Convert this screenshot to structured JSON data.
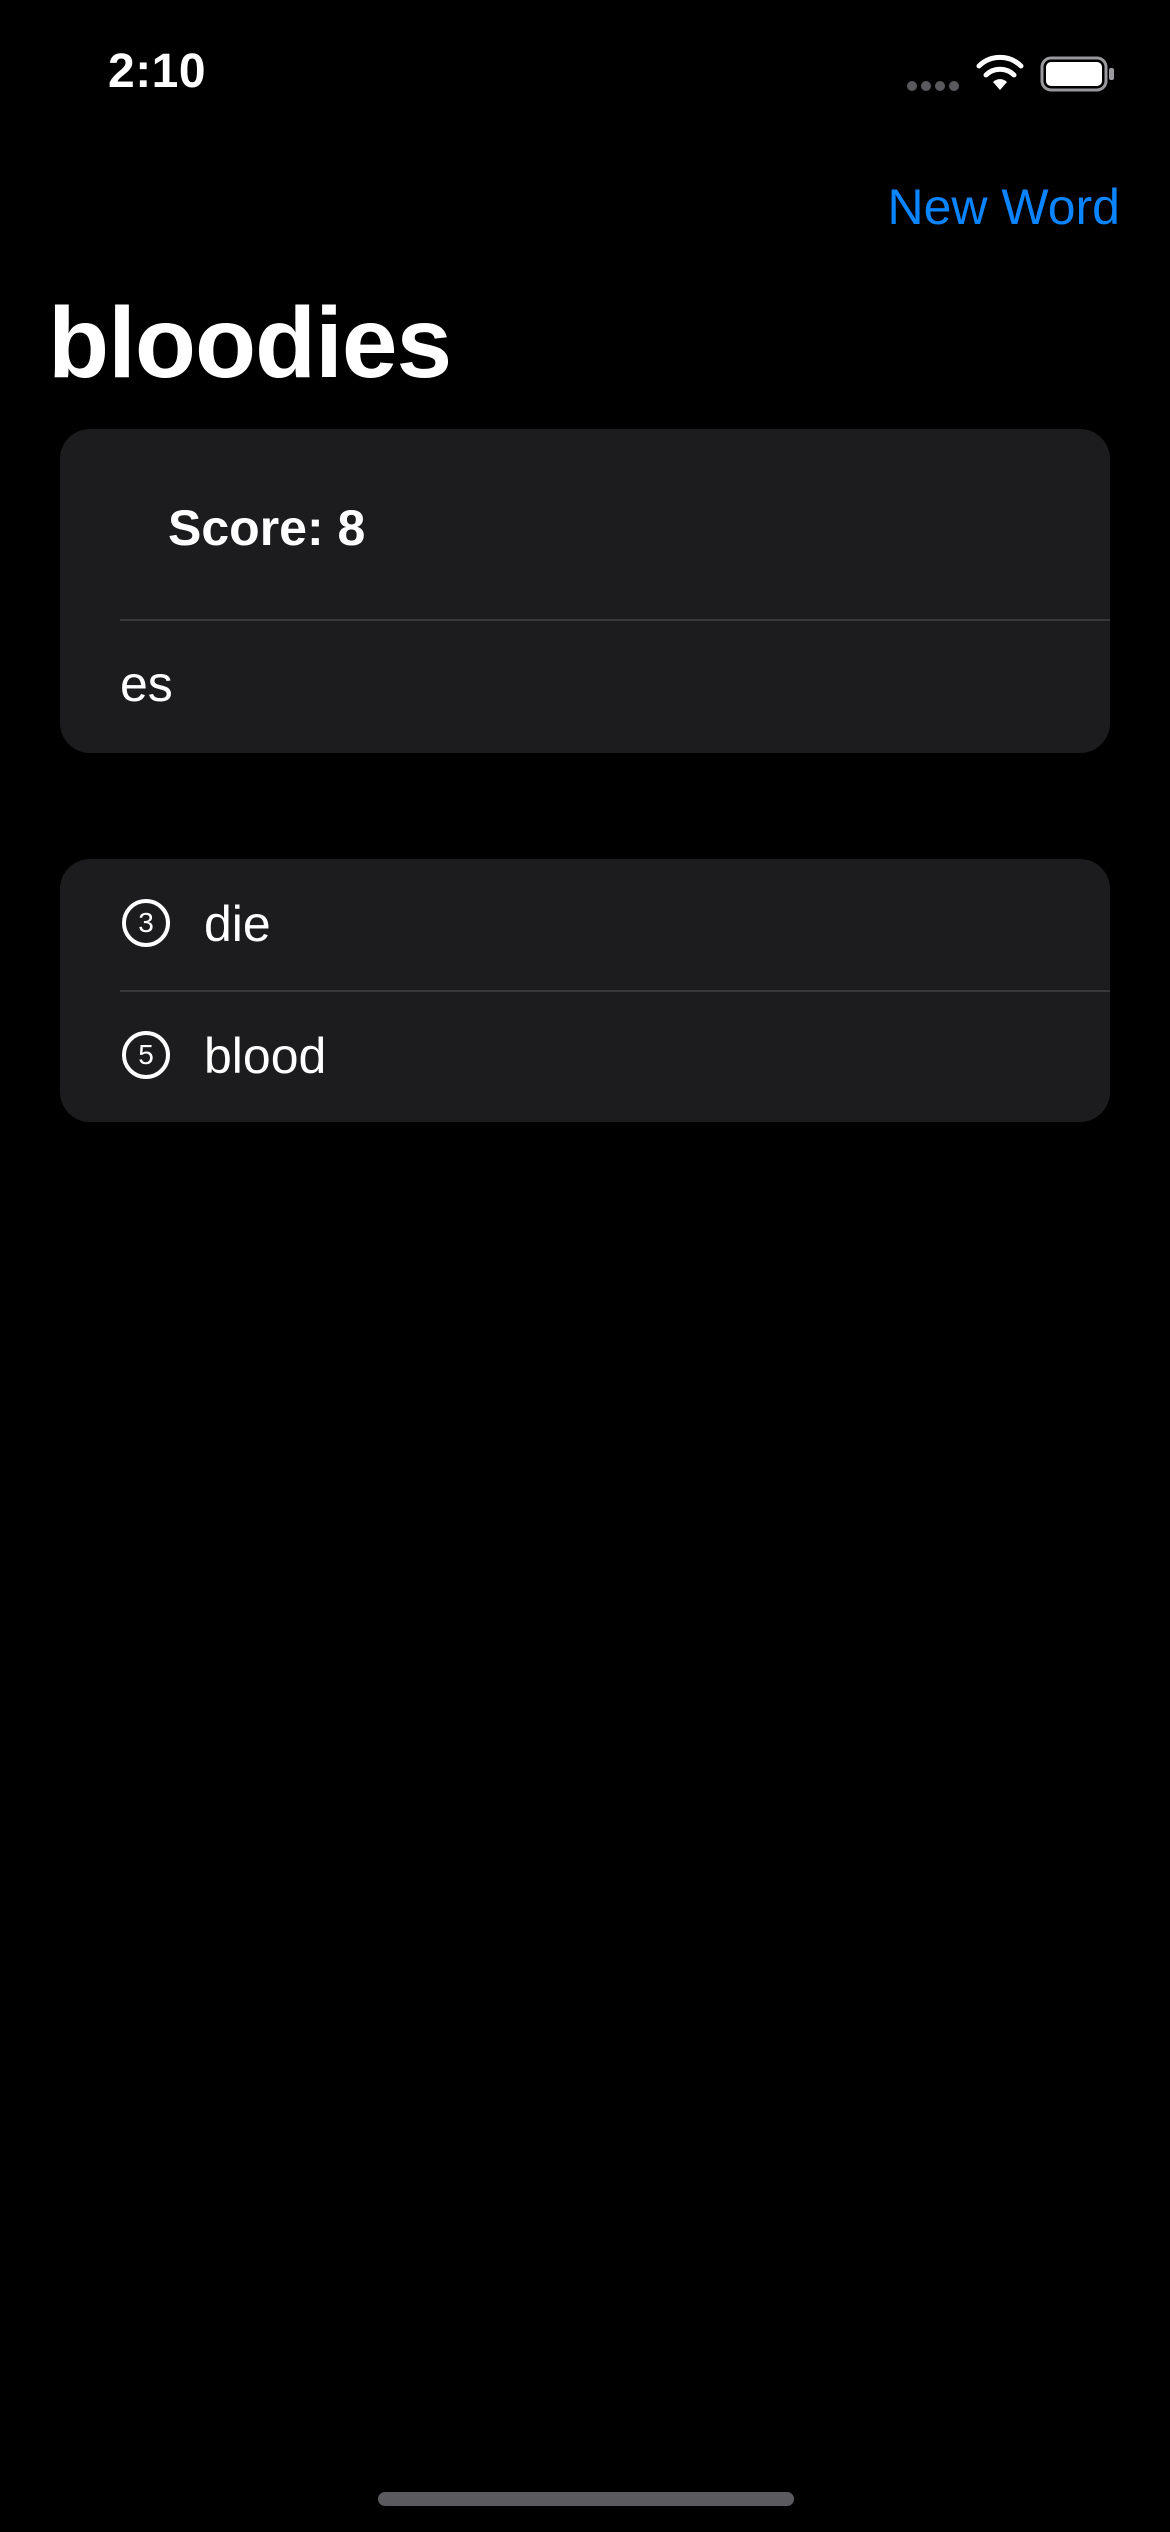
{
  "status_bar": {
    "time": "2:10",
    "signal_icon": "cellular-signal-icon",
    "wifi_icon": "wifi-icon",
    "battery_icon": "battery-icon"
  },
  "nav": {
    "new_word_label": "New Word"
  },
  "root_word": "bloodies",
  "score": {
    "label": "Score: 8"
  },
  "input": {
    "value": "es",
    "placeholder": ""
  },
  "used_words": [
    {
      "length": "3",
      "word": "die"
    },
    {
      "length": "5",
      "word": "blood"
    }
  ],
  "colors": {
    "accent": "#0a84ff",
    "background": "#000000",
    "card": "#1c1c1e",
    "separator": "#38383a"
  }
}
